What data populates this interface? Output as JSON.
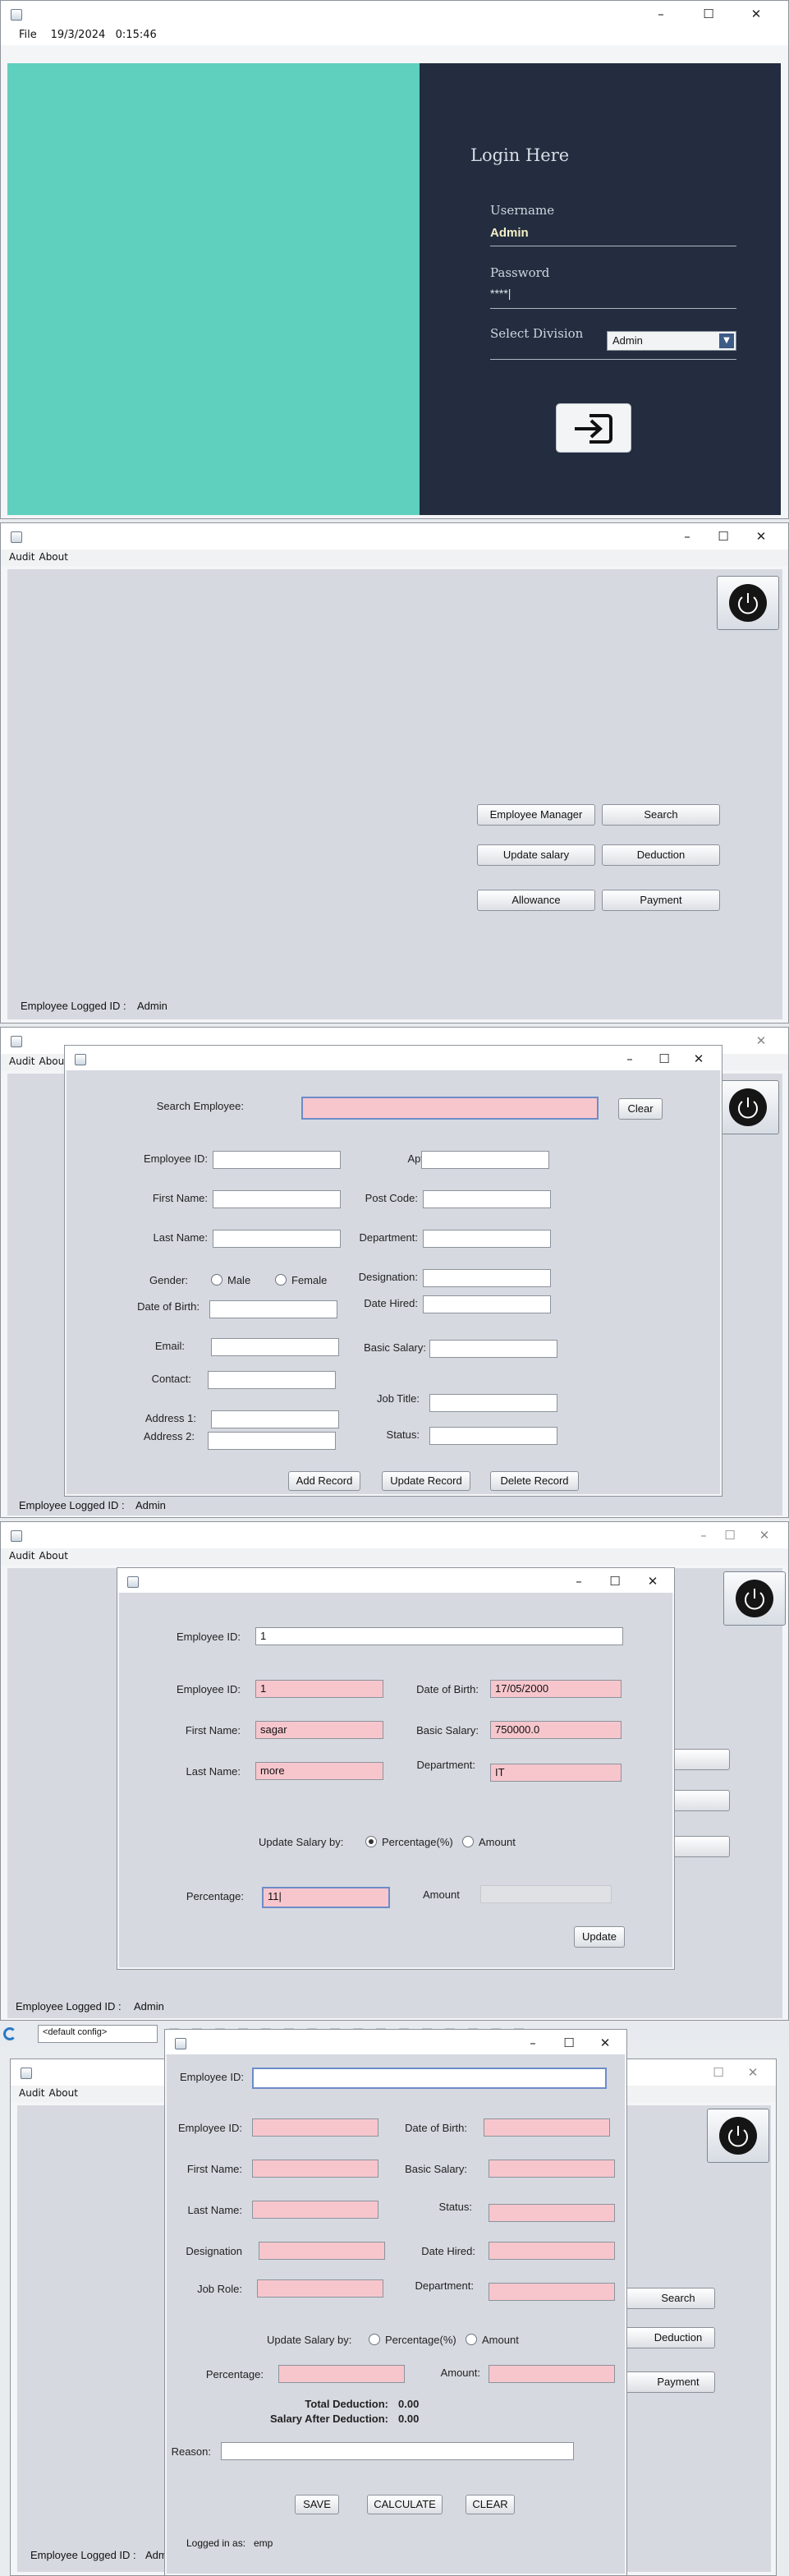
{
  "colors": {
    "teal": "#5fd0bd",
    "navy": "#232d3f",
    "pink_field": "#f7c6cd",
    "panel": "#d6d9e0"
  },
  "login": {
    "menu_file": "File",
    "datetime": "19/3/2024   0:15:46",
    "heading": "Login Here",
    "username_label": "Username",
    "username_value": "Admin",
    "password_label": "Password",
    "password_value": "****|",
    "division_label": "Select Division",
    "division_value": "Admin",
    "login_icon": "login-arrow-icon"
  },
  "dashboard": {
    "menu": [
      "Audit",
      "About"
    ],
    "buttons": {
      "employee_manager": "Employee Manager",
      "search": "Search",
      "update_salary": "Update salary",
      "deduction": "Deduction",
      "allowance": "Allowance",
      "payment": "Payment"
    },
    "status_label": "Employee Logged ID :",
    "status_value": "Admin",
    "power_icon": "power-icon"
  },
  "employee_manager": {
    "search_label": "Search Employee:",
    "search_value": "",
    "clear": "Clear",
    "labels": {
      "employee_id": "Employee ID:",
      "first_name": "First Name:",
      "last_name": "Last Name:",
      "gender": "Gender:",
      "male": "Male",
      "female": "Female",
      "dob": "Date of Birth:",
      "email": "Email:",
      "contact": "Contact:",
      "address1": "Address 1:",
      "address2": "Address 2:",
      "apt_house": "Apt/House No:",
      "post_code": "Post Code:",
      "department": "Department:",
      "designation": "Designation:",
      "date_hired": "Date Hired:",
      "basic_salary": "Basic Salary:",
      "job_title": "Job Title:",
      "status": "Status:"
    },
    "buttons": {
      "add": "Add Record",
      "update": "Update Record",
      "delete": "Delete Record"
    },
    "status_label": "Employee Logged ID :",
    "status_value": "Admin"
  },
  "update_salary": {
    "labels": {
      "employee_id_top": "Employee ID:",
      "employee_id": "Employee ID:",
      "first_name": "First Name:",
      "last_name": "Last Name:",
      "dob": "Date of Birth:",
      "basic_salary": "Basic Salary:",
      "department": "Department:",
      "update_by": "Update Salary by:",
      "percentage_opt": "Percentage(%)",
      "amount_opt": "Amount",
      "percentage": "Percentage:",
      "amount": "Amount"
    },
    "values": {
      "employee_id_top": "1",
      "employee_id": "1",
      "first_name": "sagar",
      "last_name": "more",
      "dob": "17/05/2000",
      "basic_salary": "750000.0",
      "department": "IT",
      "percentage": "11|",
      "amount": ""
    },
    "update_button": "Update",
    "status_label": "Employee Logged ID :",
    "status_value": "Admin",
    "ide_config": "<default config>"
  },
  "deduction": {
    "labels": {
      "employee_id_top": "Employee ID:",
      "employee_id": "Employee ID:",
      "first_name": "First Name:",
      "last_name": "Last Name:",
      "designation": "Designation",
      "job_role": "Job Role:",
      "dob": "Date of Birth:",
      "basic_salary": "Basic Salary:",
      "status": "Status:",
      "date_hired": "Date Hired:",
      "department": "Department:",
      "update_by": "Update Salary by:",
      "percentage_opt": "Percentage(%)",
      "amount_opt": "Amount",
      "percentage": "Percentage:",
      "amount": "Amount:",
      "total_deduction": "Total Deduction:",
      "salary_after": "Salary After Deduction:",
      "reason": "Reason:"
    },
    "values": {
      "total_deduction": "0.00",
      "salary_after": "0.00"
    },
    "buttons": {
      "save": "SAVE",
      "calculate": "CALCULATE",
      "clear": "CLEAR"
    },
    "logged_in_label": "Logged in as:",
    "logged_in_value": "emp",
    "bg_buttons": {
      "search": "Search",
      "deduction": "Deduction",
      "payment": "Payment"
    },
    "bg_menu": [
      "Audit",
      "About"
    ],
    "bg_status_label": "Employee Logged ID :",
    "bg_status_value": "Adm"
  }
}
